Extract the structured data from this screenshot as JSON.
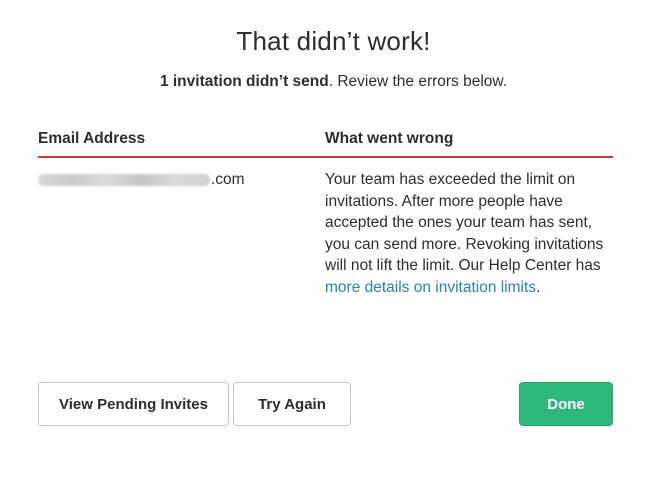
{
  "dialog": {
    "title": "That didn’t work!",
    "subtitle_strong": "1 invitation didn’t send",
    "subtitle_rest": ". Review the errors below."
  },
  "table": {
    "headers": [
      "Email Address",
      "What went wrong"
    ],
    "rows": [
      {
        "email_suffix": ".com",
        "error_text": "Your team has exceeded the limit on invitations. After more people have accepted the ones your team has sent, you can send more. Revoking invitations will not lift the limit. Our Help Center has ",
        "error_link": "more details on invitation limits",
        "error_end": "."
      }
    ]
  },
  "buttons": {
    "view_pending": "View Pending Invites",
    "try_again": "Try Again",
    "done": "Done"
  },
  "colors": {
    "accent_red": "#c6393b",
    "link_blue": "#2a80b9",
    "done_green": "#2eb67d"
  }
}
